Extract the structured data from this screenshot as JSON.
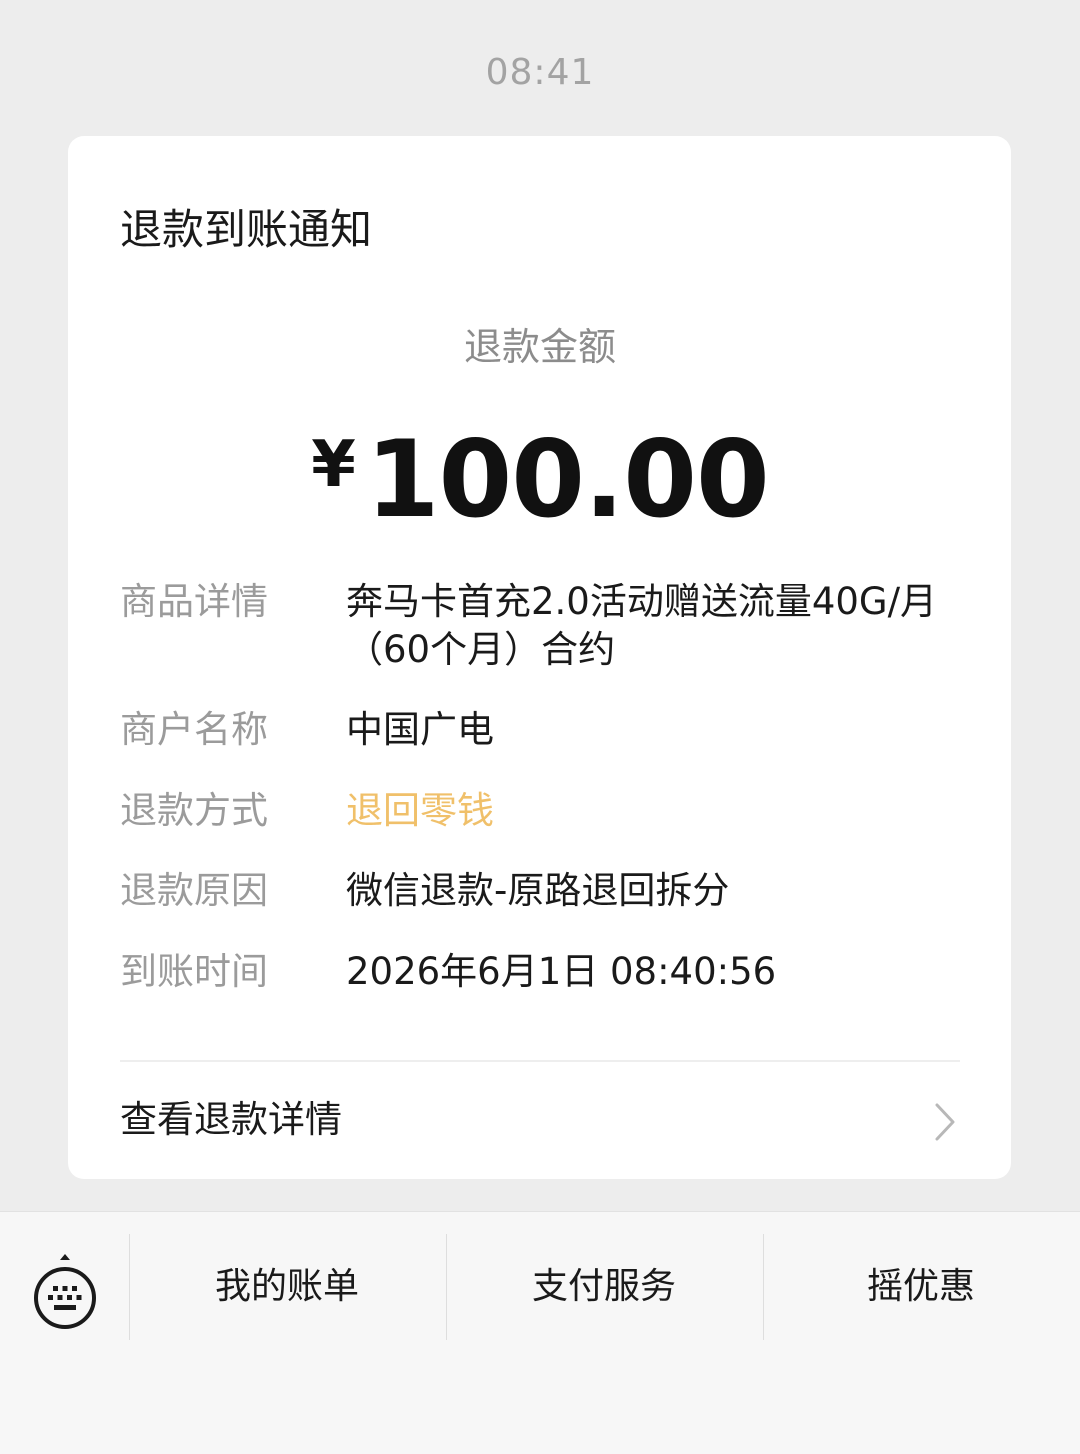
{
  "timestamp": "08:41",
  "card": {
    "title": "退款到账通知",
    "amount_label": "退款金额",
    "currency_symbol": "¥",
    "amount": "100.00",
    "details": [
      {
        "label": "商品详情",
        "value": "奔马卡首充2.0活动赠送流量40G/月（60个月）合约"
      },
      {
        "label": "商户名称",
        "value": "中国广电"
      },
      {
        "label": "退款方式",
        "value": "退回零钱"
      },
      {
        "label": "退款原因",
        "value": "微信退款-原路退回拆分"
      },
      {
        "label": "到账时间",
        "value": "2026年6月1日 08:40:56"
      }
    ],
    "view_details_label": "查看退款详情"
  },
  "bottom_menu": {
    "keyboard_icon": "keyboard-icon",
    "items": [
      {
        "label": "我的账单"
      },
      {
        "label": "支付服务"
      },
      {
        "label": "摇优惠"
      }
    ]
  },
  "colors": {
    "accent": "#f0c06a",
    "background": "#ededed",
    "card": "#ffffff"
  }
}
